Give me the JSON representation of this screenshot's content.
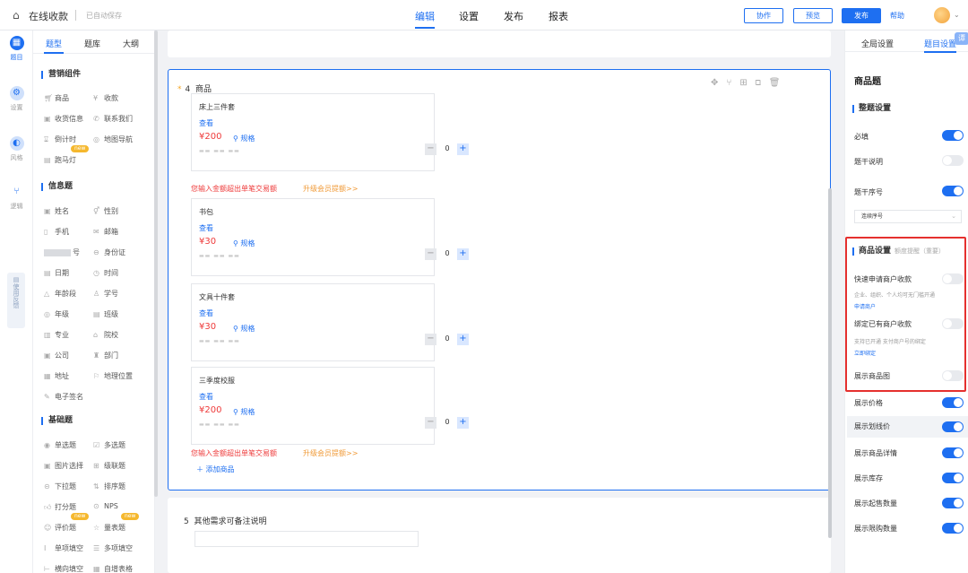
{
  "topbar": {
    "title": "在线收款",
    "autosave": "已自动保存",
    "nav": [
      "编辑",
      "设置",
      "发布",
      "报表"
    ],
    "buttons": {
      "collab": "协作",
      "preview": "预览",
      "publish": "发布"
    },
    "help": "帮助"
  },
  "rail": {
    "items": [
      "题目",
      "设置",
      "风格",
      "逻辑"
    ],
    "feedback": "使用反馈"
  },
  "panel": {
    "tabs": [
      "题型",
      "题库",
      "大纲"
    ],
    "sections": {
      "marketing": "营销组件",
      "info": "信息题",
      "basic": "基础题"
    },
    "marketing_items": [
      "商品",
      "收款",
      "收货信息",
      "联系我们",
      "倒计时",
      "地图导航",
      "跑马灯"
    ],
    "info_items": [
      "姓名",
      "性别",
      "手机",
      "邮箱",
      "号",
      "身份证",
      "日期",
      "时间",
      "年龄段",
      "学号",
      "年级",
      "班级",
      "专业",
      "院校",
      "公司",
      "部门",
      "地址",
      "地理位置",
      "电子签名"
    ],
    "basic_items": [
      "单选题",
      "多选题",
      "图片选择",
      "级联题",
      "下拉题",
      "排序题",
      "打分题",
      "NPS",
      "评价题",
      "量表题",
      "单项填空",
      "多项填空",
      "横向填空",
      "自增表格"
    ],
    "new_label": "new"
  },
  "question4": {
    "number": "4",
    "title": "商品",
    "products": [
      {
        "name": "床上三件套",
        "view": "查看",
        "price": "¥200",
        "spec": "规格",
        "qty": "0"
      },
      {
        "name": "书包",
        "view": "查看",
        "price": "¥30",
        "spec": "规格",
        "qty": "0"
      },
      {
        "name": "文具十件套",
        "view": "查看",
        "price": "¥30",
        "spec": "规格",
        "qty": "0"
      },
      {
        "name": "三季度校服",
        "view": "查看",
        "price": "¥200",
        "spec": "规格",
        "qty": "0"
      }
    ],
    "warning": "您输入金额超出单笔交易额",
    "upgrade": "升级会员提额>>",
    "add_product": "添加商品"
  },
  "question5": {
    "number": "5",
    "title": "其他需求可备注说明"
  },
  "settings": {
    "tabs": [
      "全局设置",
      "题目设置"
    ],
    "float_icon": "谭",
    "heading": "商品题",
    "section_stem": "整题设置",
    "required": "必填",
    "stem_desc": "题干说明",
    "stem_num": "题干序号",
    "numbering_select": "连续序号",
    "section_product": "商品设置",
    "section_product_sub": "额度提醒（重要）",
    "quick_merchant": "快速申请商户收款",
    "quick_merchant_help": "企业、组织、个人均可无门槛开通",
    "quick_merchant_link": "申请商户",
    "bind_merchant": "绑定已有商户收款",
    "bind_merchant_help": "支持已开通 支付商户号的绑定",
    "bind_merchant_link": "立即绑定",
    "show_image": "展示商品图",
    "show_price": "展示价格",
    "show_strike": "展示划线价",
    "show_detail": "展示商品详情",
    "show_stock": "展示库存",
    "show_min": "展示起售数量",
    "show_limit": "展示限购数量"
  }
}
